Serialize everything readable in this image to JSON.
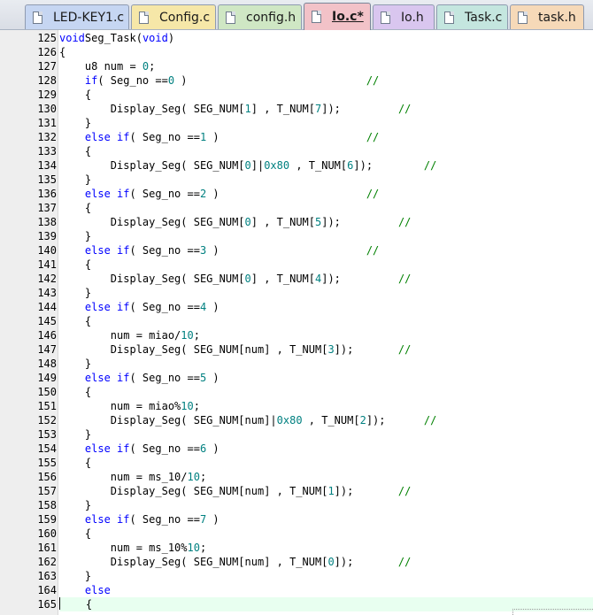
{
  "tabs": [
    {
      "label": "LED-KEY1.c",
      "color": "#c6d6f2",
      "active": false
    },
    {
      "label": "Config.c",
      "color": "#f6e7a8",
      "active": false
    },
    {
      "label": "config.h",
      "color": "#cfe7c4",
      "active": false
    },
    {
      "label": "Io.c*",
      "color": "#f2c2c8",
      "active": true
    },
    {
      "label": "Io.h",
      "color": "#d9c6ef",
      "active": false
    },
    {
      "label": "Task.c",
      "color": "#c4e6df",
      "active": false
    },
    {
      "label": "task.h",
      "color": "#f6d9b8",
      "active": false
    }
  ],
  "editor": {
    "current_line": "165",
    "lines": [
      {
        "n": "125",
        "t": [
          [
            "kw",
            "void"
          ],
          [
            "",
            "Seg_Task("
          ],
          [
            "kw",
            "void"
          ],
          [
            "",
            ")"
          ]
        ]
      },
      {
        "n": "126",
        "t": [
          [
            "",
            "{"
          ]
        ]
      },
      {
        "n": "127",
        "t": [
          [
            "",
            "    u8 num = "
          ],
          [
            "num",
            "0"
          ],
          [
            "",
            ";"
          ]
        ]
      },
      {
        "n": "128",
        "t": [
          [
            "",
            "    "
          ],
          [
            "kw",
            "if"
          ],
          [
            "",
            "( Seg_no =="
          ],
          [
            "num",
            "0"
          ],
          [
            "",
            " )                            "
          ],
          [
            "cm",
            "//"
          ]
        ]
      },
      {
        "n": "129",
        "t": [
          [
            "",
            "    {"
          ]
        ]
      },
      {
        "n": "130",
        "t": [
          [
            "",
            "        Display_Seg( SEG_NUM["
          ],
          [
            "num",
            "1"
          ],
          [
            "",
            "] , T_NUM["
          ],
          [
            "num",
            "7"
          ],
          [
            "",
            "]);         "
          ],
          [
            "cm",
            "//"
          ]
        ]
      },
      {
        "n": "131",
        "t": [
          [
            "",
            "    }"
          ]
        ]
      },
      {
        "n": "132",
        "t": [
          [
            "",
            "    "
          ],
          [
            "kw",
            "else if"
          ],
          [
            "",
            "( Seg_no =="
          ],
          [
            "num",
            "1"
          ],
          [
            "",
            " )                       "
          ],
          [
            "cm",
            "//"
          ]
        ]
      },
      {
        "n": "133",
        "t": [
          [
            "",
            "    {"
          ]
        ]
      },
      {
        "n": "134",
        "t": [
          [
            "",
            "        Display_Seg( SEG_NUM["
          ],
          [
            "num",
            "0"
          ],
          [
            "",
            "]|"
          ],
          [
            "num",
            "0x80"
          ],
          [
            "",
            " , T_NUM["
          ],
          [
            "num",
            "6"
          ],
          [
            "",
            "]);        "
          ],
          [
            "cm",
            "//"
          ]
        ]
      },
      {
        "n": "135",
        "t": [
          [
            "",
            "    }"
          ]
        ]
      },
      {
        "n": "136",
        "t": [
          [
            "",
            "    "
          ],
          [
            "kw",
            "else if"
          ],
          [
            "",
            "( Seg_no =="
          ],
          [
            "num",
            "2"
          ],
          [
            "",
            " )                       "
          ],
          [
            "cm",
            "//"
          ]
        ]
      },
      {
        "n": "137",
        "t": [
          [
            "",
            "    {"
          ]
        ]
      },
      {
        "n": "138",
        "t": [
          [
            "",
            "        Display_Seg( SEG_NUM["
          ],
          [
            "num",
            "0"
          ],
          [
            "",
            "] , T_NUM["
          ],
          [
            "num",
            "5"
          ],
          [
            "",
            "]);         "
          ],
          [
            "cm",
            "//"
          ]
        ]
      },
      {
        "n": "139",
        "t": [
          [
            "",
            "    }"
          ]
        ]
      },
      {
        "n": "140",
        "t": [
          [
            "",
            "    "
          ],
          [
            "kw",
            "else if"
          ],
          [
            "",
            "( Seg_no =="
          ],
          [
            "num",
            "3"
          ],
          [
            "",
            " )                       "
          ],
          [
            "cm",
            "//"
          ]
        ]
      },
      {
        "n": "141",
        "t": [
          [
            "",
            "    {"
          ]
        ]
      },
      {
        "n": "142",
        "t": [
          [
            "",
            "        Display_Seg( SEG_NUM["
          ],
          [
            "num",
            "0"
          ],
          [
            "",
            "] , T_NUM["
          ],
          [
            "num",
            "4"
          ],
          [
            "",
            "]);         "
          ],
          [
            "cm",
            "//"
          ]
        ]
      },
      {
        "n": "143",
        "t": [
          [
            "",
            "    }"
          ]
        ]
      },
      {
        "n": "144",
        "t": [
          [
            "",
            "    "
          ],
          [
            "kw",
            "else if"
          ],
          [
            "",
            "( Seg_no =="
          ],
          [
            "num",
            "4"
          ],
          [
            "",
            " )"
          ]
        ]
      },
      {
        "n": "145",
        "t": [
          [
            "",
            "    {"
          ]
        ]
      },
      {
        "n": "146",
        "t": [
          [
            "",
            "        num = miao/"
          ],
          [
            "num",
            "10"
          ],
          [
            "",
            ";"
          ]
        ]
      },
      {
        "n": "147",
        "t": [
          [
            "",
            "        Display_Seg( SEG_NUM[num] , T_NUM["
          ],
          [
            "num",
            "3"
          ],
          [
            "",
            "]);       "
          ],
          [
            "cm",
            "//"
          ]
        ]
      },
      {
        "n": "148",
        "t": [
          [
            "",
            "    }"
          ]
        ]
      },
      {
        "n": "149",
        "t": [
          [
            "",
            "    "
          ],
          [
            "kw",
            "else if"
          ],
          [
            "",
            "( Seg_no =="
          ],
          [
            "num",
            "5"
          ],
          [
            "",
            " )"
          ]
        ]
      },
      {
        "n": "150",
        "t": [
          [
            "",
            "    {"
          ]
        ]
      },
      {
        "n": "151",
        "t": [
          [
            "",
            "        num = miao%"
          ],
          [
            "num",
            "10"
          ],
          [
            "",
            ";"
          ]
        ]
      },
      {
        "n": "152",
        "t": [
          [
            "",
            "        Display_Seg( SEG_NUM[num]|"
          ],
          [
            "num",
            "0x80"
          ],
          [
            "",
            " , T_NUM["
          ],
          [
            "num",
            "2"
          ],
          [
            "",
            "]);      "
          ],
          [
            "cm",
            "//"
          ]
        ]
      },
      {
        "n": "153",
        "t": [
          [
            "",
            "    }"
          ]
        ]
      },
      {
        "n": "154",
        "t": [
          [
            "",
            "    "
          ],
          [
            "kw",
            "else if"
          ],
          [
            "",
            "( Seg_no =="
          ],
          [
            "num",
            "6"
          ],
          [
            "",
            " )"
          ]
        ]
      },
      {
        "n": "155",
        "t": [
          [
            "",
            "    {"
          ]
        ]
      },
      {
        "n": "156",
        "t": [
          [
            "",
            "        num = ms_10/"
          ],
          [
            "num",
            "10"
          ],
          [
            "",
            ";"
          ]
        ]
      },
      {
        "n": "157",
        "t": [
          [
            "",
            "        Display_Seg( SEG_NUM[num] , T_NUM["
          ],
          [
            "num",
            "1"
          ],
          [
            "",
            "]);       "
          ],
          [
            "cm",
            "//"
          ]
        ]
      },
      {
        "n": "158",
        "t": [
          [
            "",
            "    }"
          ]
        ]
      },
      {
        "n": "159",
        "t": [
          [
            "",
            "    "
          ],
          [
            "kw",
            "else if"
          ],
          [
            "",
            "( Seg_no =="
          ],
          [
            "num",
            "7"
          ],
          [
            "",
            " )"
          ]
        ]
      },
      {
        "n": "160",
        "t": [
          [
            "",
            "    {"
          ]
        ]
      },
      {
        "n": "161",
        "t": [
          [
            "",
            "        num = ms_10%"
          ],
          [
            "num",
            "10"
          ],
          [
            "",
            ";"
          ]
        ]
      },
      {
        "n": "162",
        "t": [
          [
            "",
            "        Display_Seg( SEG_NUM[num] , T_NUM["
          ],
          [
            "num",
            "0"
          ],
          [
            "",
            "]);       "
          ],
          [
            "cm",
            "//"
          ]
        ]
      },
      {
        "n": "163",
        "t": [
          [
            "",
            "    }"
          ]
        ]
      },
      {
        "n": "164",
        "t": [
          [
            "",
            "    "
          ],
          [
            "kw",
            "else"
          ]
        ]
      },
      {
        "n": "165",
        "t": [
          [
            "",
            "    {"
          ]
        ]
      }
    ]
  },
  "colors": {
    "keyword": "#0000ff",
    "number": "#008080",
    "comment": "#008000",
    "current_line_bg": "#e8fff0"
  },
  "icons": {
    "tab_file": "file-icon"
  }
}
